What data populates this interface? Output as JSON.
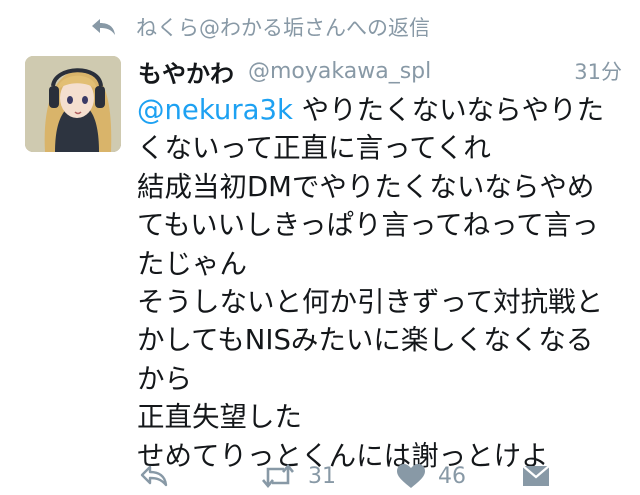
{
  "reply_context": {
    "icon": "reply-arrow-icon",
    "text": "ねくら@わかる垢さんへの返信"
  },
  "tweet": {
    "name": "もやかわ",
    "handle": "@moyakawa_spl",
    "time": "31分",
    "avatar_icon": "anime-character-avatar",
    "mention": "@nekura3k",
    "lines": [
      " やりたくないならやりた",
      "くないって正直に言ってくれ",
      "結成当初DMでやりたくないならやめ",
      "てもいいしきっぱり言ってねって言っ",
      "たじゃん",
      "そうしないと何か引きずって対抗戦と",
      "かしてもNISみたいに楽しくなくなる",
      "から",
      "正直失望した",
      "せめてりっとくんには謝っとけよ"
    ]
  },
  "actions": {
    "reply_icon": "reply-icon",
    "retweet_icon": "retweet-icon",
    "retweet_count": "31",
    "like_icon": "heart-icon",
    "like_count": "46",
    "dm_icon": "envelope-icon"
  },
  "colors": {
    "accent": "#1da1f2",
    "muted": "#8899a6",
    "text": "#14171a"
  }
}
